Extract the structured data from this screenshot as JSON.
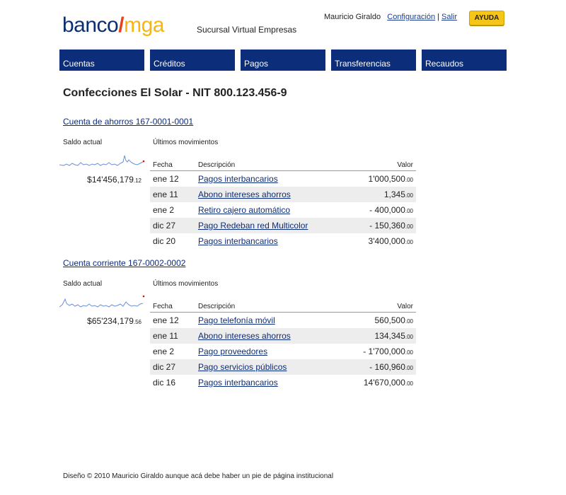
{
  "logo": {
    "part1": "banco",
    "slash": "/",
    "part2": "mga"
  },
  "subtitle": "Sucursal Virtual Empresas",
  "userbar": {
    "user": "Mauricio Giraldo",
    "config": "Configuración",
    "sep": "|",
    "logout": "Salir"
  },
  "help_label": "AYUDA",
  "nav": [
    "Cuentas",
    "Créditos",
    "Pagos",
    "Transferencias",
    "Recaudos"
  ],
  "company": "Confecciones El Solar - NIT 800.123.456-9",
  "accounts": [
    {
      "title": "Cuenta de ahorros 167-0001-0001",
      "balance_label": "Saldo actual",
      "movements_label": "Últimos movimientos",
      "balance_main": "$14'456,179",
      "balance_cents": ".12",
      "headers": {
        "date": "Fecha",
        "desc": "Descripción",
        "value": "Valor"
      },
      "rows": [
        {
          "date": "ene 12",
          "desc": "Pagos interbancarios",
          "value": "1'000,500",
          "cents": ".00"
        },
        {
          "date": "ene 11",
          "desc": "Abono intereses ahorros",
          "value": "1,345",
          "cents": ".00"
        },
        {
          "date": "ene 2",
          "desc": "Retiro cajero automático",
          "value": "- 400,000",
          "cents": ".00"
        },
        {
          "date": "dic 27",
          "desc": "Pago Redeban red Multicolor",
          "value": "- 150,360",
          "cents": ".00"
        },
        {
          "date": "dic 20",
          "desc": "Pagos interbancarios",
          "value": "3'400,000",
          "cents": ".00"
        }
      ]
    },
    {
      "title": "Cuenta corriente 167-0002-0002",
      "balance_label": "Saldo actual",
      "movements_label": "Últimos movimientos",
      "balance_main": "$65'234,179",
      "balance_cents": ".56",
      "headers": {
        "date": "Fecha",
        "desc": "Descripción",
        "value": "Valor"
      },
      "rows": [
        {
          "date": "ene 12",
          "desc": "Pago telefonía móvil",
          "value": "560,500",
          "cents": ".00"
        },
        {
          "date": "ene 11",
          "desc": "Abono intereses ahorros",
          "value": "134,345",
          "cents": ".00"
        },
        {
          "date": "ene 2",
          "desc": "Pago proveedores",
          "value": "- 1'700,000",
          "cents": ".00"
        },
        {
          "date": "dic 27",
          "desc": "Pago servicios públicos",
          "value": "- 160,960",
          "cents": ".00"
        },
        {
          "date": "dic 16",
          "desc": "Pagos interbancarios",
          "value": "14'670,000",
          "cents": ".00"
        }
      ]
    }
  ],
  "footer": "Diseño © 2010 Mauricio Giraldo aunque acá debe haber un pie de página institucional",
  "colors": {
    "nav_bg": "#0c2d7a",
    "logo_blue": "#0b2f6e",
    "logo_slash": "#e8421a",
    "logo_yellow": "#f5b60f",
    "help_bg": "#f5c518",
    "spark": "#6a8fd8",
    "spark_end": "#d01010"
  }
}
